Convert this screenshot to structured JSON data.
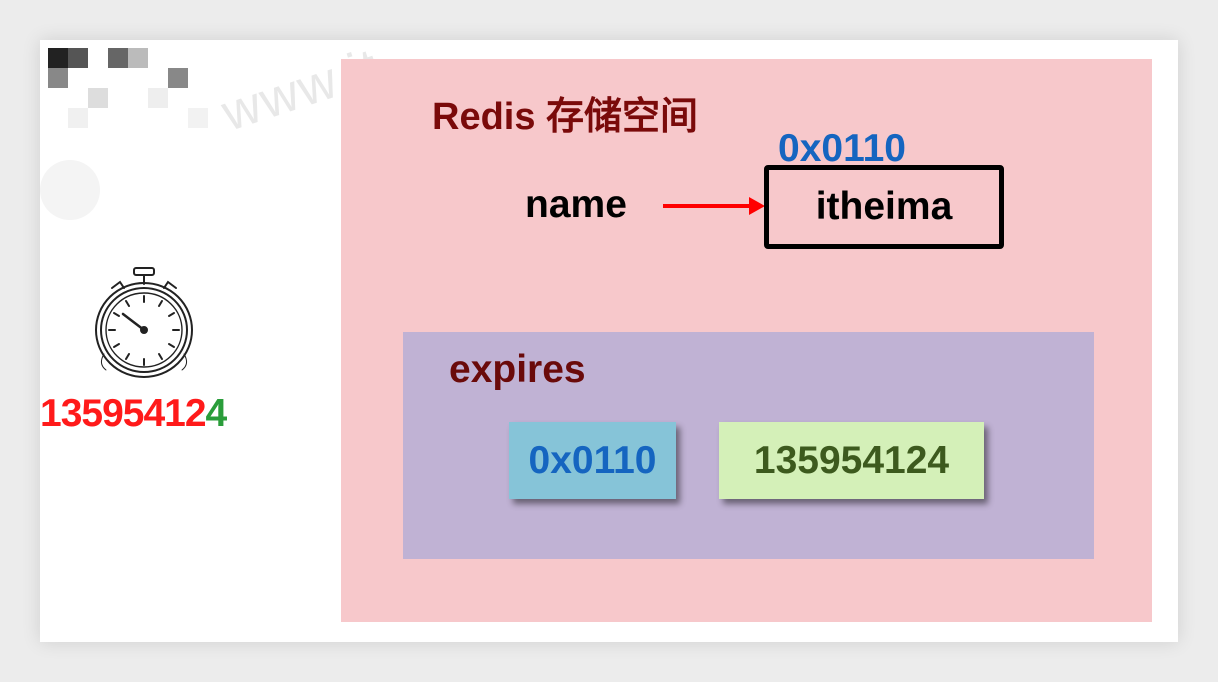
{
  "redis": {
    "title": "Redis 存储空间",
    "key": "name",
    "address": "0x0110",
    "value": "itheima"
  },
  "expires": {
    "label": "expires",
    "address": "0x0110",
    "timestamp": "135954124"
  },
  "timer": {
    "value_prefix": "13595412",
    "value_last": "4",
    "icon": "stopwatch-icon"
  },
  "watermark": {
    "text": "www.it"
  },
  "colors": {
    "redis_bg": "#f7c8cb",
    "expires_bg": "#c0b2d4",
    "address_box": "#86c4d8",
    "timestamp_box": "#d4f0b8",
    "title_color": "#7a0a0a",
    "address_text": "#1565c0",
    "timer_text": "#ff1a1a",
    "arrow": "#ff0000"
  }
}
